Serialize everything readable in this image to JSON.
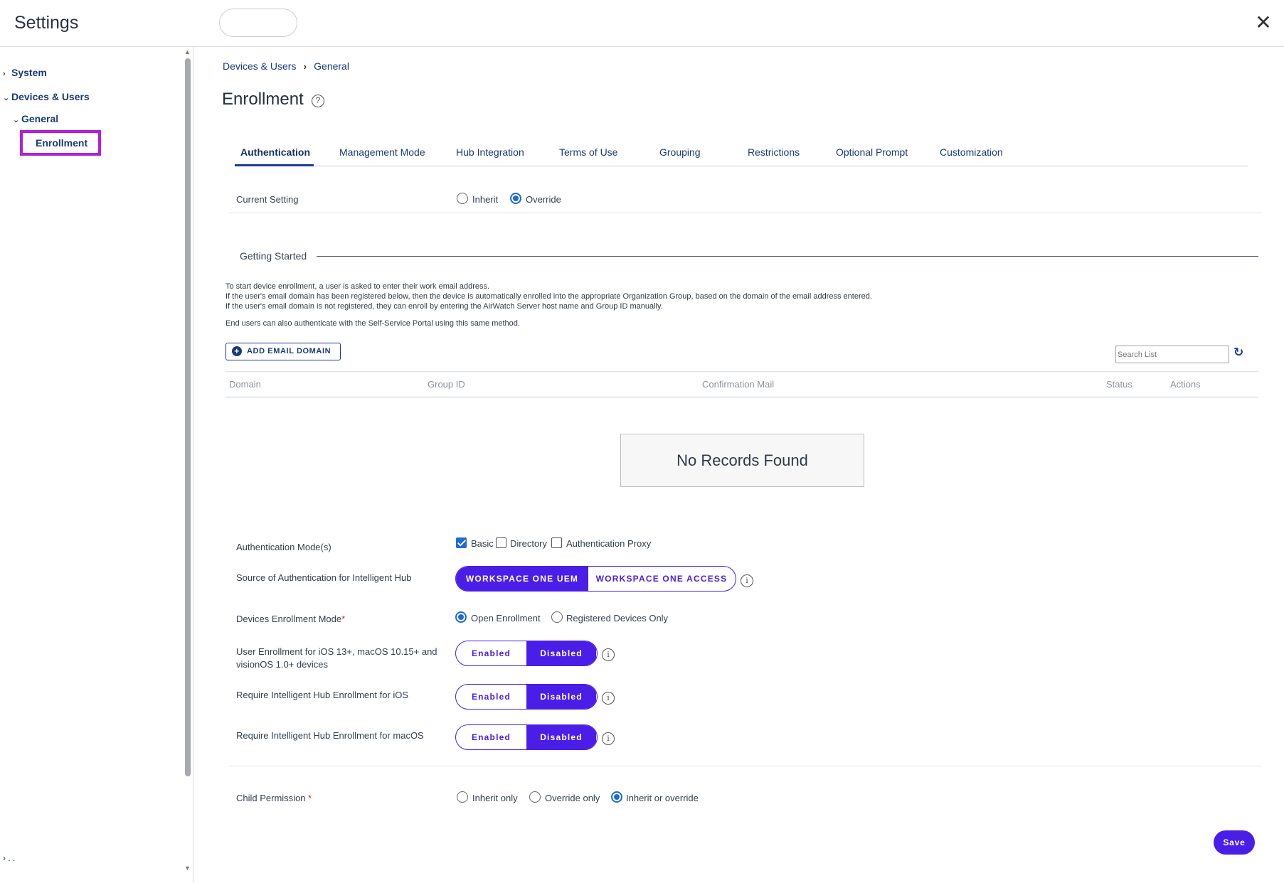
{
  "header": {
    "title": "Settings",
    "close_icon": "close-icon"
  },
  "sidebar": {
    "items": [
      {
        "label": "System",
        "icon": "chevron-right-icon"
      },
      {
        "label": "Devices & Users",
        "icon": "chevron-down-icon"
      },
      {
        "label": "General",
        "icon": "chevron-down-icon"
      },
      {
        "label": "Enrollment",
        "selected": true
      }
    ],
    "bottom_text": ". ."
  },
  "breadcrumb": {
    "items": [
      "Devices & Users",
      "General"
    ]
  },
  "page": {
    "title": "Enrollment",
    "help_icon": "help-icon"
  },
  "tabs": [
    {
      "label": "Authentication",
      "active": true
    },
    {
      "label": "Management Mode"
    },
    {
      "label": "Hub Integration"
    },
    {
      "label": "Terms of Use"
    },
    {
      "label": "Grouping"
    },
    {
      "label": "Restrictions"
    },
    {
      "label": "Optional Prompt"
    },
    {
      "label": "Customization"
    }
  ],
  "current_setting": {
    "label": "Current Setting",
    "options": [
      "Inherit",
      "Override"
    ],
    "selected": "Override"
  },
  "getting_started": {
    "title": "Getting Started",
    "lines": [
      "To start device enrollment, a user is asked to enter their work email address.",
      "If the user's email domain has been registered below, then the device is automatically enrolled into the appropriate Organization Group, based on the domain of the email address entered.",
      "If the user's email domain is not registered, they can enroll by entering the AirWatch Server host name and Group ID manually.",
      "End users can also authenticate with the Self-Service Portal using this same method."
    ],
    "add_button": "ADD EMAIL DOMAIN",
    "search_placeholder": "Search List",
    "columns": [
      "Domain",
      "Group ID",
      "Confirmation Mail",
      "Status",
      "Actions"
    ],
    "empty_text": "No Records Found"
  },
  "form": {
    "auth_modes": {
      "label": "Authentication Mode(s)",
      "options": [
        {
          "label": "Basic",
          "checked": true
        },
        {
          "label": "Directory",
          "checked": false
        },
        {
          "label": "Authentication Proxy",
          "checked": false
        }
      ]
    },
    "source_auth": {
      "label": "Source of Authentication for Intelligent Hub",
      "options": [
        "WORKSPACE ONE UEM",
        "WORKSPACE ONE ACCESS"
      ],
      "selected": "WORKSPACE ONE UEM"
    },
    "enrollment_mode": {
      "label": "Devices Enrollment Mode",
      "required": "*",
      "options": [
        "Open Enrollment",
        "Registered Devices Only"
      ],
      "selected": "Open Enrollment"
    },
    "user_enrollment": {
      "label_line1": "User Enrollment for iOS 13+, macOS 10.15+ and",
      "label_line2": "visionOS 1.0+ devices",
      "options": [
        "Enabled",
        "Disabled"
      ],
      "selected": "Disabled"
    },
    "hub_ios": {
      "label": "Require Intelligent Hub Enrollment for iOS",
      "options": [
        "Enabled",
        "Disabled"
      ],
      "selected": "Disabled"
    },
    "hub_macos": {
      "label": "Require Intelligent Hub Enrollment for macOS",
      "options": [
        "Enabled",
        "Disabled"
      ],
      "selected": "Disabled"
    },
    "child_permission": {
      "label": "Child Permission",
      "required": "*",
      "options": [
        "Inherit only",
        "Override only",
        "Inherit or override"
      ],
      "selected": "Inherit or override"
    }
  },
  "save_label": "Save",
  "colors": {
    "accent": "#4b1ee8",
    "link": "#1a3a7a",
    "radio": "#1e6ad6",
    "selection_outline": "#b21ee0"
  }
}
